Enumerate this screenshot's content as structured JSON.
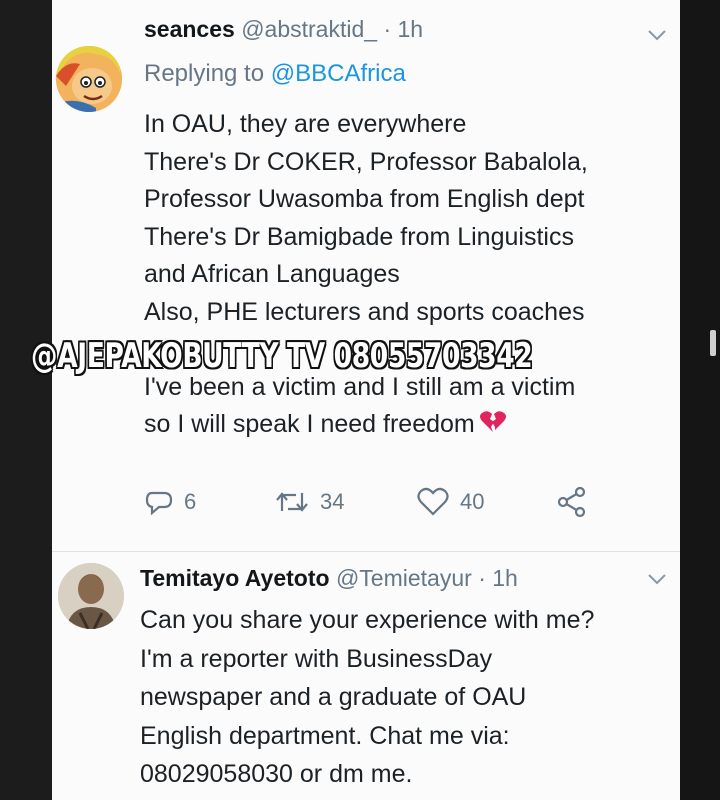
{
  "tweets": [
    {
      "display_name": "seances",
      "handle": "@abstraktid_",
      "time": "· 1h",
      "replying_label": "Replying to",
      "replying_to": "@BBCAfrica",
      "lines": [
        "In OAU, they are everywhere",
        "There's Dr COKER, Professor Babalola,",
        "Professor Uwasomba from English dept",
        "There's Dr Bamigbade from Linguistics",
        "and African Languages",
        "Also, PHE lecturers and sports coaches",
        "",
        "I've been a victim and I still am a victim",
        "so I will speak I need freedom"
      ],
      "replies": "6",
      "retweets": "34",
      "likes": "40"
    },
    {
      "display_name": "Temitayo Ayetoto",
      "handle": "@Temietayur",
      "time": "· 1h",
      "lines": [
        "Can you share your experience with me?",
        "I'm a reporter with BusinessDay",
        "newspaper and a graduate of OAU",
        "English department. Chat me via:",
        "08029058030 or dm me."
      ]
    }
  ],
  "watermark": "@AJEPAKOBUTTY TV 08055703342",
  "colors": {
    "link": "#1b95e0",
    "muted": "#657786",
    "text": "#1c2126",
    "heart": "#e0245e"
  },
  "icons": [
    "reply-icon",
    "retweet-icon",
    "like-icon",
    "share-icon",
    "chevron-down-icon",
    "broken-heart-icon"
  ]
}
